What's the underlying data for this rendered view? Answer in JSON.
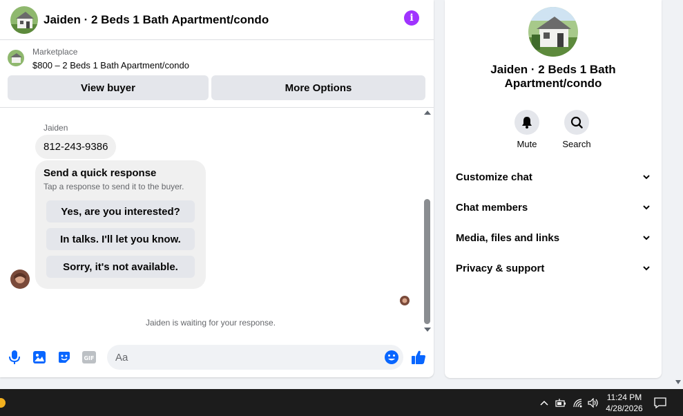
{
  "chat": {
    "title": "Jaiden · 2 Beds 1 Bath Apartment/condo",
    "listing": {
      "source": "Marketplace",
      "price_title": "$800 – 2 Beds 1 Bath Apartment/condo"
    },
    "buttons": {
      "view_buyer": "View buyer",
      "more_options": "More Options"
    },
    "sender_name": "Jaiden",
    "phone_message": "812-243-9386",
    "quick_response": {
      "title": "Send a quick response",
      "subtitle": "Tap a response to send it to the buyer.",
      "options": [
        "Yes, are you interested?",
        "In talks. I'll let you know.",
        "Sorry, it's not available."
      ]
    },
    "waiting_text": "Jaiden is waiting for your response.",
    "composer": {
      "placeholder": "Aa"
    }
  },
  "info_panel": {
    "title": "Jaiden · 2 Beds 1 Bath Apartment/condo",
    "actions": [
      {
        "label": "Mute",
        "icon": "bell-icon"
      },
      {
        "label": "Search",
        "icon": "search-icon"
      }
    ],
    "sections": [
      "Customize chat",
      "Chat members",
      "Media, files and links",
      "Privacy & support"
    ]
  },
  "taskbar": {
    "time": "11:24 PM",
    "date": "4/28/2026"
  },
  "colors": {
    "accent": "#0866ff",
    "info_purple": "#a033ff",
    "bubble": "#f0f0f0",
    "taskbar": "#1c1c1c"
  }
}
